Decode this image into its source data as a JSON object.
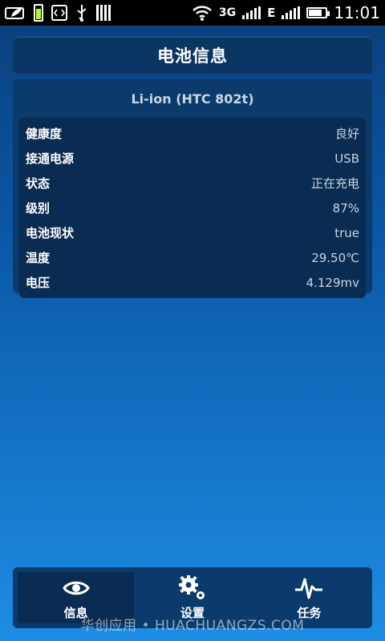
{
  "status_bar": {
    "network_type": "3G",
    "data_type": "E",
    "time": "11:01"
  },
  "header": {
    "title": "电池信息"
  },
  "battery": {
    "model": "Li-ion (HTC 802t)",
    "rows": [
      {
        "label": "健康度",
        "value": "良好"
      },
      {
        "label": "接通电源",
        "value": "USB"
      },
      {
        "label": "状态",
        "value": "正在充电"
      },
      {
        "label": "级别",
        "value": "87%"
      },
      {
        "label": "电池现状",
        "value": "true"
      },
      {
        "label": "温度",
        "value": "29.50℃"
      },
      {
        "label": "电压",
        "value": "4.129mv"
      }
    ]
  },
  "nav": {
    "items": [
      {
        "label": "信息",
        "icon": "eye-icon"
      },
      {
        "label": "设置",
        "icon": "gear-icon"
      },
      {
        "label": "任务",
        "icon": "pulse-icon"
      }
    ]
  },
  "watermark": "华创应用 • HUACHUANGZS.COM"
}
